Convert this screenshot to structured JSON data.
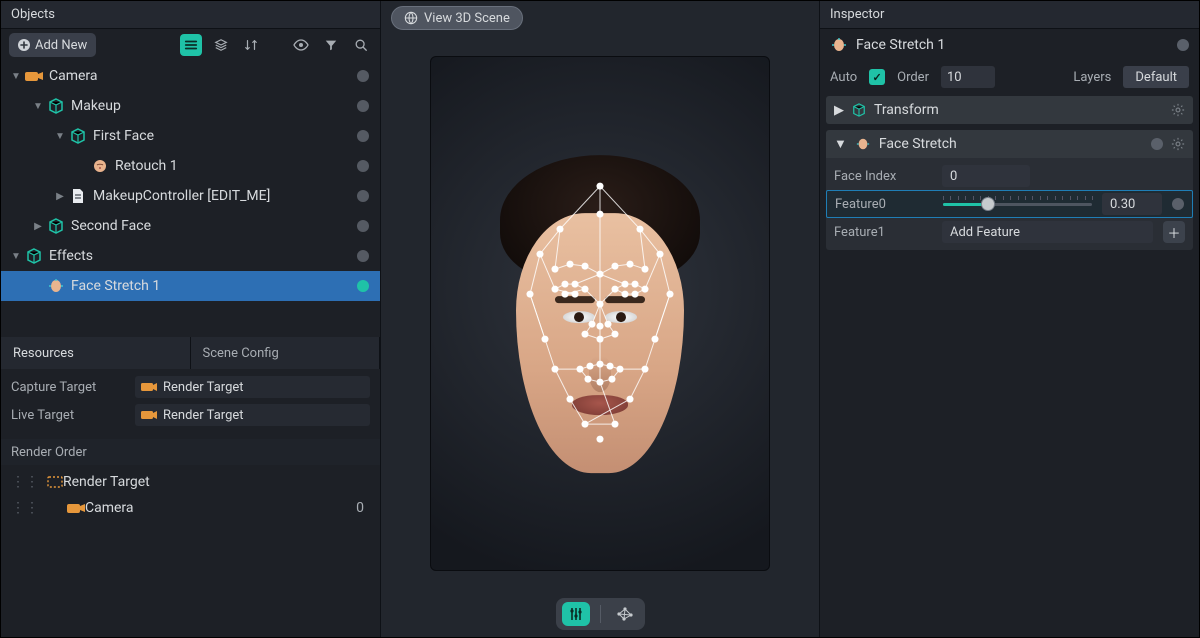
{
  "panels": {
    "objects_title": "Objects",
    "inspector_title": "Inspector"
  },
  "toolbar": {
    "add_new_label": "Add New"
  },
  "tree": [
    {
      "indent": 0,
      "arrow": "down",
      "icon": "camera",
      "label": "Camera",
      "selected": false,
      "interactable": true
    },
    {
      "indent": 1,
      "arrow": "down",
      "icon": "scene",
      "label": "Makeup",
      "selected": false,
      "interactable": true
    },
    {
      "indent": 2,
      "arrow": "down",
      "icon": "scene",
      "label": "First Face",
      "selected": false,
      "interactable": true
    },
    {
      "indent": 3,
      "arrow": "none",
      "icon": "retouch",
      "label": "Retouch 1",
      "selected": false,
      "interactable": true
    },
    {
      "indent": 2,
      "arrow": "right",
      "icon": "script",
      "label": "MakeupController [EDIT_ME]",
      "selected": false,
      "interactable": true
    },
    {
      "indent": 1,
      "arrow": "right",
      "icon": "scene",
      "label": "Second Face",
      "selected": false,
      "interactable": true
    },
    {
      "indent": 0,
      "arrow": "down",
      "icon": "scene",
      "label": "Effects",
      "selected": false,
      "interactable": true
    },
    {
      "indent": 1,
      "arrow": "none",
      "icon": "facestretch",
      "label": "Face Stretch 1",
      "selected": true,
      "interactable": true
    }
  ],
  "tabs": {
    "resources": "Resources",
    "scene_config": "Scene Config",
    "active": "resources"
  },
  "targets": {
    "capture_key": "Capture Target",
    "capture_val": "Render Target",
    "live_key": "Live Target",
    "live_val": "Render Target"
  },
  "render_order": {
    "title": "Render Order",
    "rows": [
      {
        "indent": 0,
        "icon": "rt",
        "label": "Render Target",
        "count": ""
      },
      {
        "indent": 1,
        "icon": "camera",
        "label": "Camera",
        "count": "0"
      }
    ]
  },
  "center": {
    "view3d_label": "View 3D Scene"
  },
  "inspector": {
    "object_name": "Face Stretch 1",
    "auto_label": "Auto",
    "auto_checked": true,
    "order_label": "Order",
    "order_value": "10",
    "layers_label": "Layers",
    "layers_value": "Default",
    "components": {
      "transform": {
        "title": "Transform",
        "collapsed": true
      },
      "facestretch": {
        "title": "Face Stretch",
        "face_index_label": "Face Index",
        "face_index_value": "0",
        "feature0_label": "Feature0",
        "feature0_value": "0.30",
        "feature0_ratio": 0.3,
        "feature1_label": "Feature1",
        "add_feature_label": "Add Feature"
      }
    }
  }
}
